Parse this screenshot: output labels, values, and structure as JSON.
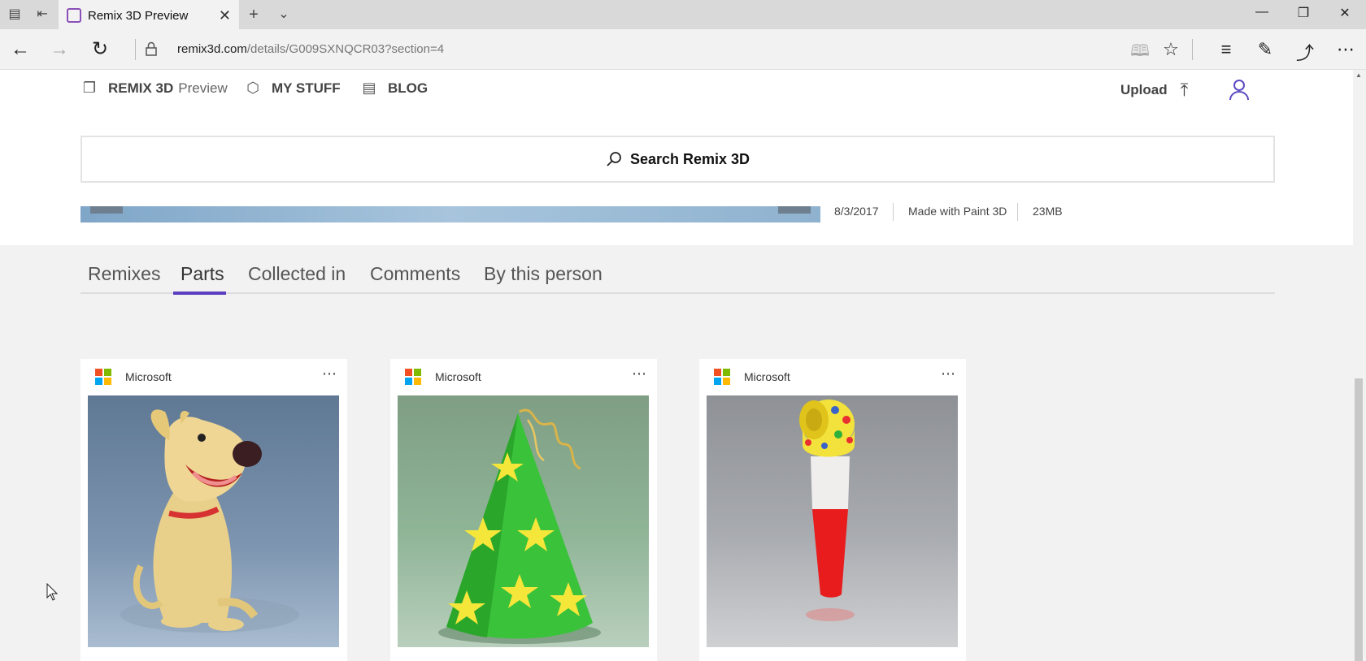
{
  "browser": {
    "tab_title": "Remix 3D Preview",
    "url_host": "remix3d.com",
    "url_path": "/details/G009SXNQCR03?section=4",
    "icons": [
      "back-arrow-icon",
      "forward-arrow-icon",
      "refresh-icon",
      "lock-icon",
      "reading-view-icon",
      "favorite-star-icon",
      "hub-icon",
      "pen-icon",
      "share-icon",
      "more-icon"
    ]
  },
  "site_nav": {
    "brand_bold": "REMIX 3D",
    "brand_light": "Preview",
    "my_stuff": "MY STUFF",
    "blog": "BLOG",
    "upload": "Upload"
  },
  "search": {
    "label": "Search Remix 3D"
  },
  "meta": {
    "date": "8/3/2017",
    "made_with": "Made with Paint 3D",
    "size": "23MB"
  },
  "tabs": {
    "remixes": "Remixes",
    "parts": "Parts",
    "collected_in": "Collected in",
    "comments": "Comments",
    "by_this_person": "By this person",
    "active": "Parts"
  },
  "cards": [
    {
      "author": "Microsoft",
      "more": "⋯",
      "thumb": "cartoon-dog"
    },
    {
      "author": "Microsoft",
      "more": "⋯",
      "thumb": "party-hat"
    },
    {
      "author": "Microsoft",
      "more": "⋯",
      "thumb": "party-blower"
    }
  ],
  "colors": {
    "accent": "#5b3fbf",
    "ms_red": "#f25022",
    "ms_green": "#7fba00",
    "ms_blue": "#00a4ef",
    "ms_yellow": "#ffb900"
  }
}
